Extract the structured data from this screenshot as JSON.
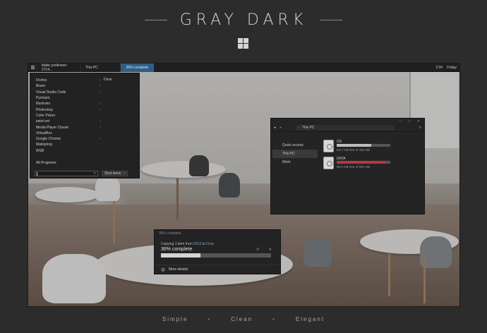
{
  "header": {
    "title": "GRAY DARK",
    "logo_icon": "windows-logo-icon"
  },
  "tagline": {
    "words": [
      "Simple",
      "Clean",
      "Elegant"
    ],
    "separator": "•"
  },
  "taskbar": {
    "menu_icon": "hamburger-icon",
    "items": [
      "blake-yorkinson-2714...",
      "This PC"
    ],
    "progress_label": "36% complete",
    "clock": "2:34",
    "day": "Friday",
    "colors": {
      "background": "#1f1f1f",
      "progress": "#2e5e86"
    }
  },
  "start_menu": {
    "apps": [
      {
        "label": "Firefox",
        "arrow": "›"
      },
      {
        "label": "Brave",
        "arrow": "›"
      },
      {
        "label": "Visual Studio Code",
        "arrow": "›"
      },
      {
        "label": "Pycharm",
        "arrow": ""
      },
      {
        "label": "Illustrator",
        "arrow": "›"
      },
      {
        "label": "Photoshop",
        "arrow": "›"
      },
      {
        "label": "Color Picker",
        "arrow": ""
      },
      {
        "label": "paint.net",
        "arrow": "›"
      },
      {
        "label": "Media Player Classic",
        "arrow": "›"
      },
      {
        "label": "VirtualBox",
        "arrow": ""
      },
      {
        "label": "Google Chrome",
        "arrow": "›"
      },
      {
        "label": "Mailspring",
        "arrow": ""
      },
      {
        "label": "WSB",
        "arrow": ""
      }
    ],
    "all_programs": "All Programs",
    "right_items": [
      "Drive"
    ],
    "search_icon": "search-icon",
    "shutdown_label": "Shut down",
    "shutdown_arrow": "›"
  },
  "explorer": {
    "window_controls": [
      "—",
      "□",
      "✕"
    ],
    "nav": [
      "◂",
      "▸"
    ],
    "address": "This PC",
    "address_chevron": "›",
    "search_icon": "search-icon",
    "sidebar": [
      "Quick access",
      "This PC",
      "Work"
    ],
    "sidebar_selected": "This PC",
    "drives": [
      {
        "name": "OS",
        "free": "53.7 GB free of 154 GB",
        "used_fraction": 0.65,
        "color": "#bdbdbd"
      },
      {
        "name": "DATA",
        "free": "99.3 GB free of 931 GB",
        "used_fraction": 0.89,
        "color": "#b0393f"
      }
    ]
  },
  "copy_dialog": {
    "header": "36% complete",
    "line_prefix": "Copying 1 item from",
    "source": "5823",
    "line_mid": "to",
    "destination": "Drop",
    "percent_label": "36% complete",
    "progress": 0.36,
    "pause_icon": "II",
    "close_icon": "✕",
    "more_details": "More details",
    "more_icon": "⌄"
  }
}
